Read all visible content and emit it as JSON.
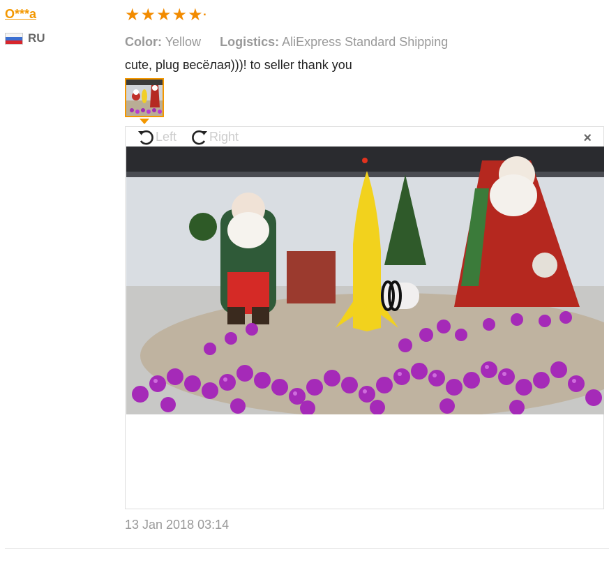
{
  "review": {
    "user_name": "O***a",
    "country_code": "RU",
    "rating": 5,
    "color_key": "Color:",
    "color_value": "Yellow",
    "logistics_key": "Logistics:",
    "logistics_value": "AliExpress Standard Shipping",
    "text": "cute, plug весёлая)))! to seller thank you",
    "date": "13 Jan 2018 03:14"
  },
  "viewer": {
    "rotate_left_label": "Left",
    "rotate_right_label": "Right",
    "close_label": "×"
  },
  "colors": {
    "accent": "#f39700",
    "star": "#f28b00",
    "muted": "#999999"
  }
}
